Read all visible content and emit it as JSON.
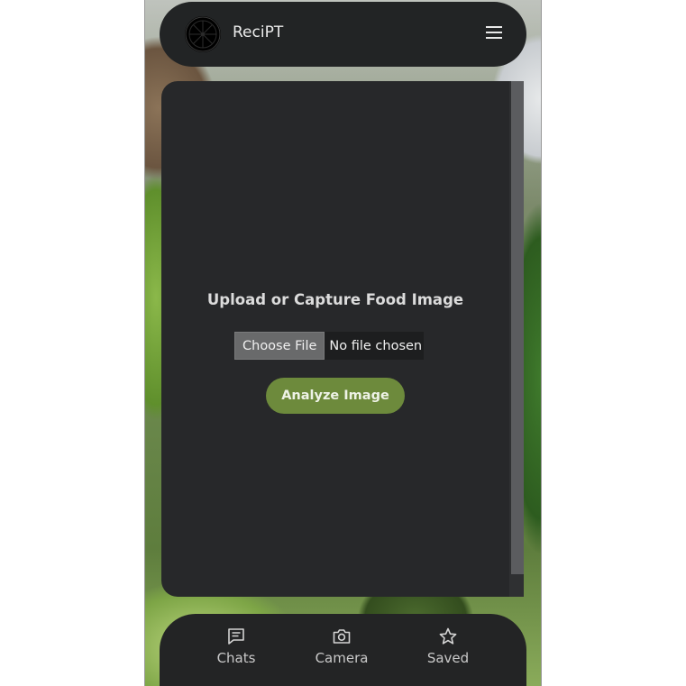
{
  "header": {
    "title": "ReciPT",
    "logo_icon": "lime-slice-icon",
    "menu_icon": "hamburger-menu-icon"
  },
  "main": {
    "heading": "Upload or Capture Food Image",
    "file_input": {
      "button_label": "Choose File",
      "status": "No file chosen"
    },
    "analyze_label": "Analyze Image"
  },
  "nav": {
    "items": [
      {
        "label": "Chats",
        "icon": "chat-icon"
      },
      {
        "label": "Camera",
        "icon": "camera-icon"
      },
      {
        "label": "Saved",
        "icon": "star-icon"
      }
    ]
  },
  "colors": {
    "panel": "#27282a",
    "header": "#222425",
    "accent": "#6d8a3c"
  }
}
